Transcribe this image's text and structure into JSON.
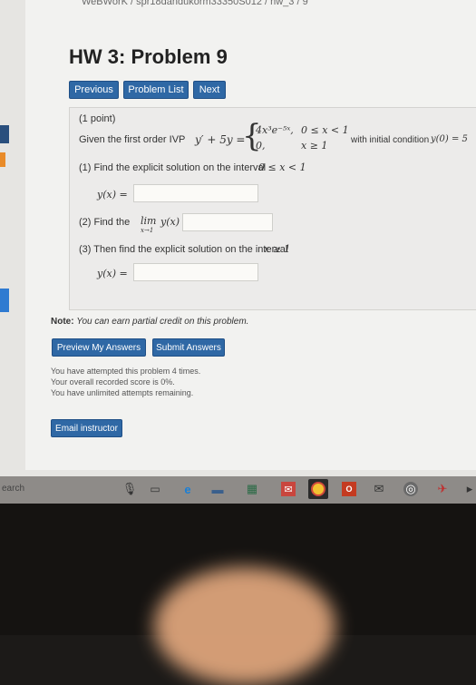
{
  "breadcrumb": "WeBWorK / spr18dandukorm33350S012 / hw_3 / 9",
  "title": "HW 3: Problem 9",
  "nav": {
    "previous": "Previous",
    "problem_list": "Problem List",
    "next": "Next"
  },
  "problem": {
    "points": "(1 point)",
    "given": "Given the first order IVP",
    "lhs": "y′ + 5y =",
    "case1_expr": "4x³e⁻⁵ˣ,",
    "case1_cond": "0 ≤ x < 1",
    "case2_expr": "0,",
    "case2_cond": "x ≥ 1",
    "initial_prefix": "with initial condition",
    "initial_cond": "y(0) = 5",
    "part1_text": "(1) Find the explicit solution on the interval",
    "part1_interval": "0 ≤ x < 1",
    "part1_label": "y(x) =",
    "part1_value": "",
    "part2_text": "(2) Find the",
    "part2_lim": "lim",
    "part2_sub": "x→1",
    "part2_expr": "y(x) =",
    "part2_value": "",
    "part3_text": "(3) Then find the explicit solution on the interval",
    "part3_interval": "x ≥ 1",
    "part3_label": "y(x) =",
    "part3_value": ""
  },
  "note": {
    "label": "Note:",
    "text": "You can earn partial credit on this problem."
  },
  "actions": {
    "preview": "Preview My Answers",
    "submit": "Submit Answers"
  },
  "status": {
    "attempts": "You have attempted this problem 4 times.",
    "score": "Your overall recorded score is 0%.",
    "remaining": "You have unlimited attempts remaining."
  },
  "email_button": "Email instructor",
  "taskbar": {
    "search_fragment": "earch"
  },
  "colors": {
    "button_blue": "#2f68a5",
    "page_bg": "#f2f2f0",
    "left_accent": "#2f68a5"
  }
}
